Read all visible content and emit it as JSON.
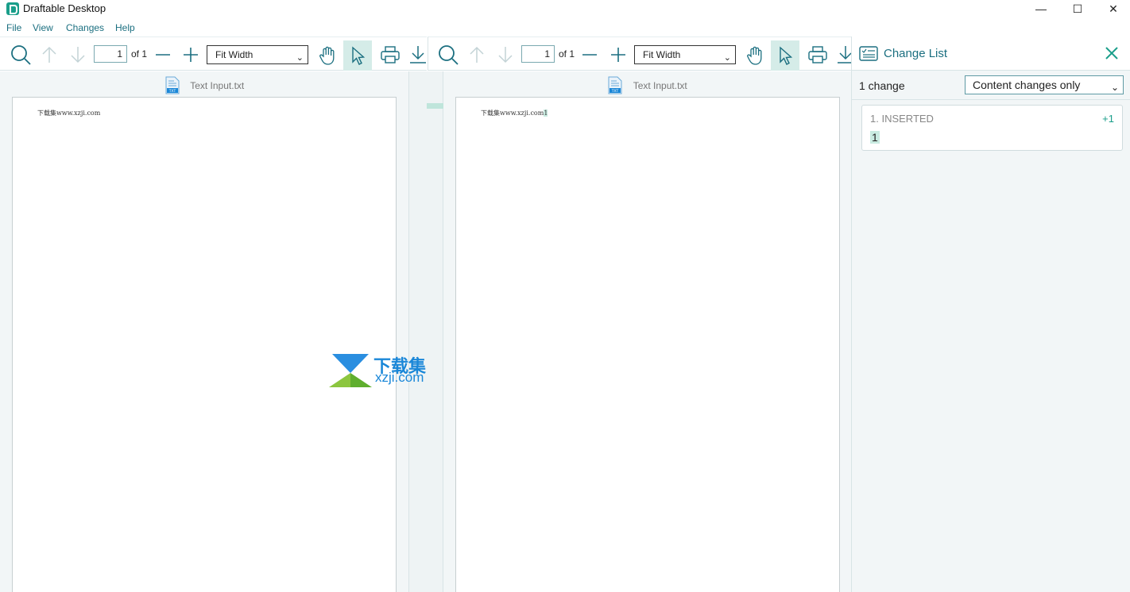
{
  "window": {
    "title": "Draftable Desktop",
    "minimize_glyph": "—",
    "maximize_glyph": "☐",
    "close_glyph": "✕"
  },
  "menu": [
    "File",
    "View",
    "Changes",
    "Help"
  ],
  "left_toolbar": {
    "page_value": "1",
    "of_label": "of 1",
    "zoom": "Fit Width"
  },
  "right_toolbar": {
    "page_value": "1",
    "of_label": "of 1",
    "zoom": "Fit Width"
  },
  "left_doc": {
    "file_name": "Text Input.txt",
    "content": "下载集www.xzji.com"
  },
  "right_doc": {
    "file_name": "Text Input.txt",
    "content_base": "下载集www.xzji.com",
    "content_inserted": "1"
  },
  "change_list": {
    "title": "Change List",
    "count_label": "1 change",
    "filter": "Content changes only",
    "changes": [
      {
        "type": "1. INSERTED",
        "count": "+1",
        "text": "1"
      }
    ]
  },
  "watermark": {
    "title": "下载集",
    "domain": "xzji.com"
  },
  "colors": {
    "accent": "#1a9e8a",
    "link": "#1b6f80",
    "inserted_bg": "#c9ebe1",
    "panel_bg": "#f2f6f7"
  }
}
